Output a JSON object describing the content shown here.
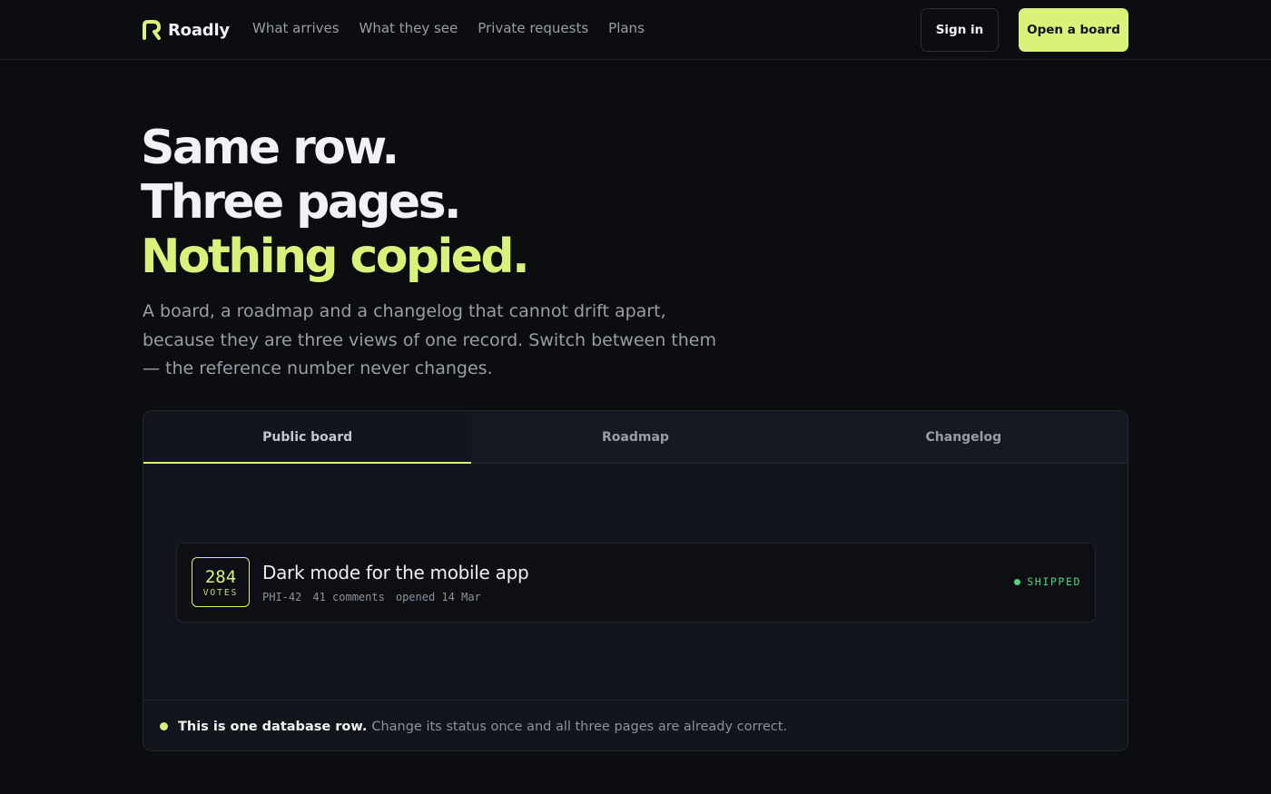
{
  "header": {
    "brand": "Roadly",
    "nav": [
      "What arrives",
      "What they see",
      "Private requests",
      "Plans"
    ],
    "sign_in": "Sign in",
    "cta": "Open a board"
  },
  "hero": {
    "line1": "Same row.",
    "line2": "Three pages.",
    "line3": "Nothing copied.",
    "subtitle": "A board, a roadmap and a changelog that cannot drift apart, because they are three views of one record. Switch between them — the reference number never changes."
  },
  "panel": {
    "tabs": [
      "Public board",
      "Roadmap",
      "Changelog"
    ],
    "active_tab": "Public board",
    "card": {
      "votes": "284",
      "votes_label": "VOTES",
      "title": "Dark mode for the mobile app",
      "ref": "PHI-42",
      "comments": "41 comments",
      "opened": "opened 14 Mar",
      "status": "SHIPPED"
    },
    "footnote_bold": "This is one database row.",
    "footnote_rest": "Change its status once and all three pages are already correct."
  },
  "colors": {
    "accent": "#d9f27a",
    "background": "#0c0d11",
    "status_shipped": "#52d67a"
  },
  "icons": {
    "brand_mark": "roadly-logo-icon",
    "status": "status-dot-icon"
  }
}
